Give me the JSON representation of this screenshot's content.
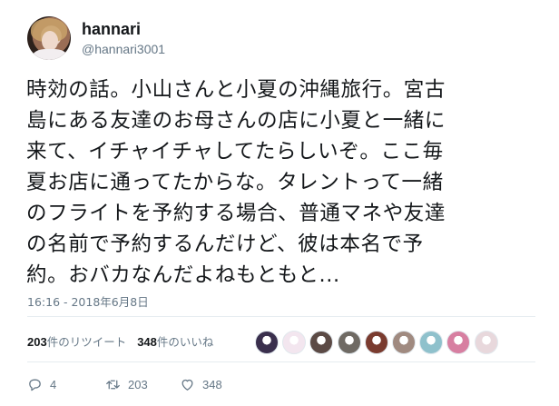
{
  "user": {
    "name": "hannari",
    "handle": "@hannari3001"
  },
  "tweet": {
    "lines": [
      "時効の話。小山さんと小夏の沖縄旅行。宮古",
      "島にある友達のお母さんの店に小夏と一緒に",
      "来て、イチャイチャしてたらしいぞ。ここ毎",
      "夏お店に通ってたからな。タレントって一緒",
      "のフライトを予約する場合、普通マネや友達",
      "の名前で予約するんだけど、彼は本名で予",
      "約。おバカなんだよねもともと..."
    ],
    "timestamp": "16:16 - 2018年6月8日"
  },
  "stats": {
    "retweets_count": "203",
    "retweets_label": "件のリツイート",
    "likes_count": "348",
    "likes_label": "件のいいね"
  },
  "liker_avatars": [
    {
      "name": "liker-avatar-1",
      "color": "#3a2f4d"
    },
    {
      "name": "liker-avatar-2",
      "color": "#f3e6ef"
    },
    {
      "name": "liker-avatar-3",
      "color": "#5b4a45"
    },
    {
      "name": "liker-avatar-4",
      "color": "#6f6a64"
    },
    {
      "name": "liker-avatar-5",
      "color": "#7a3b2f"
    },
    {
      "name": "liker-avatar-6",
      "color": "#a08a80"
    },
    {
      "name": "liker-avatar-7",
      "color": "#8fc1cc"
    },
    {
      "name": "liker-avatar-8",
      "color": "#d77fa1"
    },
    {
      "name": "liker-avatar-9",
      "color": "#e8d8dc"
    }
  ],
  "actions": {
    "reply_count": "4",
    "retweet_count": "203",
    "like_count": "348"
  },
  "colors": {
    "text": "#14171a",
    "muted": "#657786",
    "divider": "#e6ecf0"
  }
}
